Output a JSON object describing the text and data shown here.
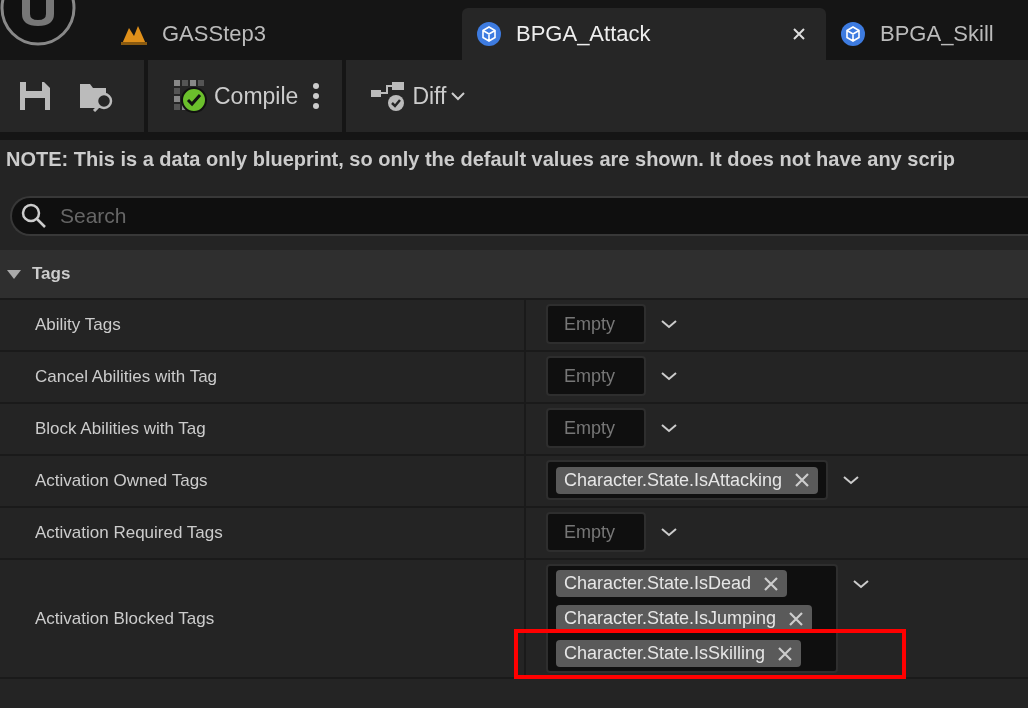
{
  "tabs": [
    {
      "label": "GASStep3",
      "kind": "level",
      "selected": false
    },
    {
      "label": "BPGA_Attack",
      "kind": "blueprint",
      "selected": true
    },
    {
      "label": "BPGA_Skill",
      "kind": "blueprint",
      "selected": false
    }
  ],
  "toolbar": {
    "compile_label": "Compile",
    "diff_label": "Diff"
  },
  "note": "NOTE: This is a data only blueprint, so only the default values are shown.  It does not have any scrip",
  "search": {
    "placeholder": "Search"
  },
  "section": {
    "title": "Tags",
    "expanded": true
  },
  "rows": [
    {
      "label": "Ability Tags",
      "empty_text": "Empty",
      "tags": []
    },
    {
      "label": "Cancel Abilities with Tag",
      "empty_text": "Empty",
      "tags": []
    },
    {
      "label": "Block Abilities with Tag",
      "empty_text": "Empty",
      "tags": []
    },
    {
      "label": "Activation Owned Tags",
      "tags": [
        {
          "text": "Character.State.IsAttacking",
          "highlighted": false
        }
      ]
    },
    {
      "label": "Activation Required Tags",
      "empty_text": "Empty",
      "tags": []
    },
    {
      "label": "Activation Blocked Tags",
      "tags": [
        {
          "text": "Character.State.IsDead",
          "highlighted": false
        },
        {
          "text": "Character.State.IsJumping",
          "highlighted": false
        },
        {
          "text": "Character.State.IsSkilling",
          "highlighted": true
        }
      ]
    }
  ]
}
